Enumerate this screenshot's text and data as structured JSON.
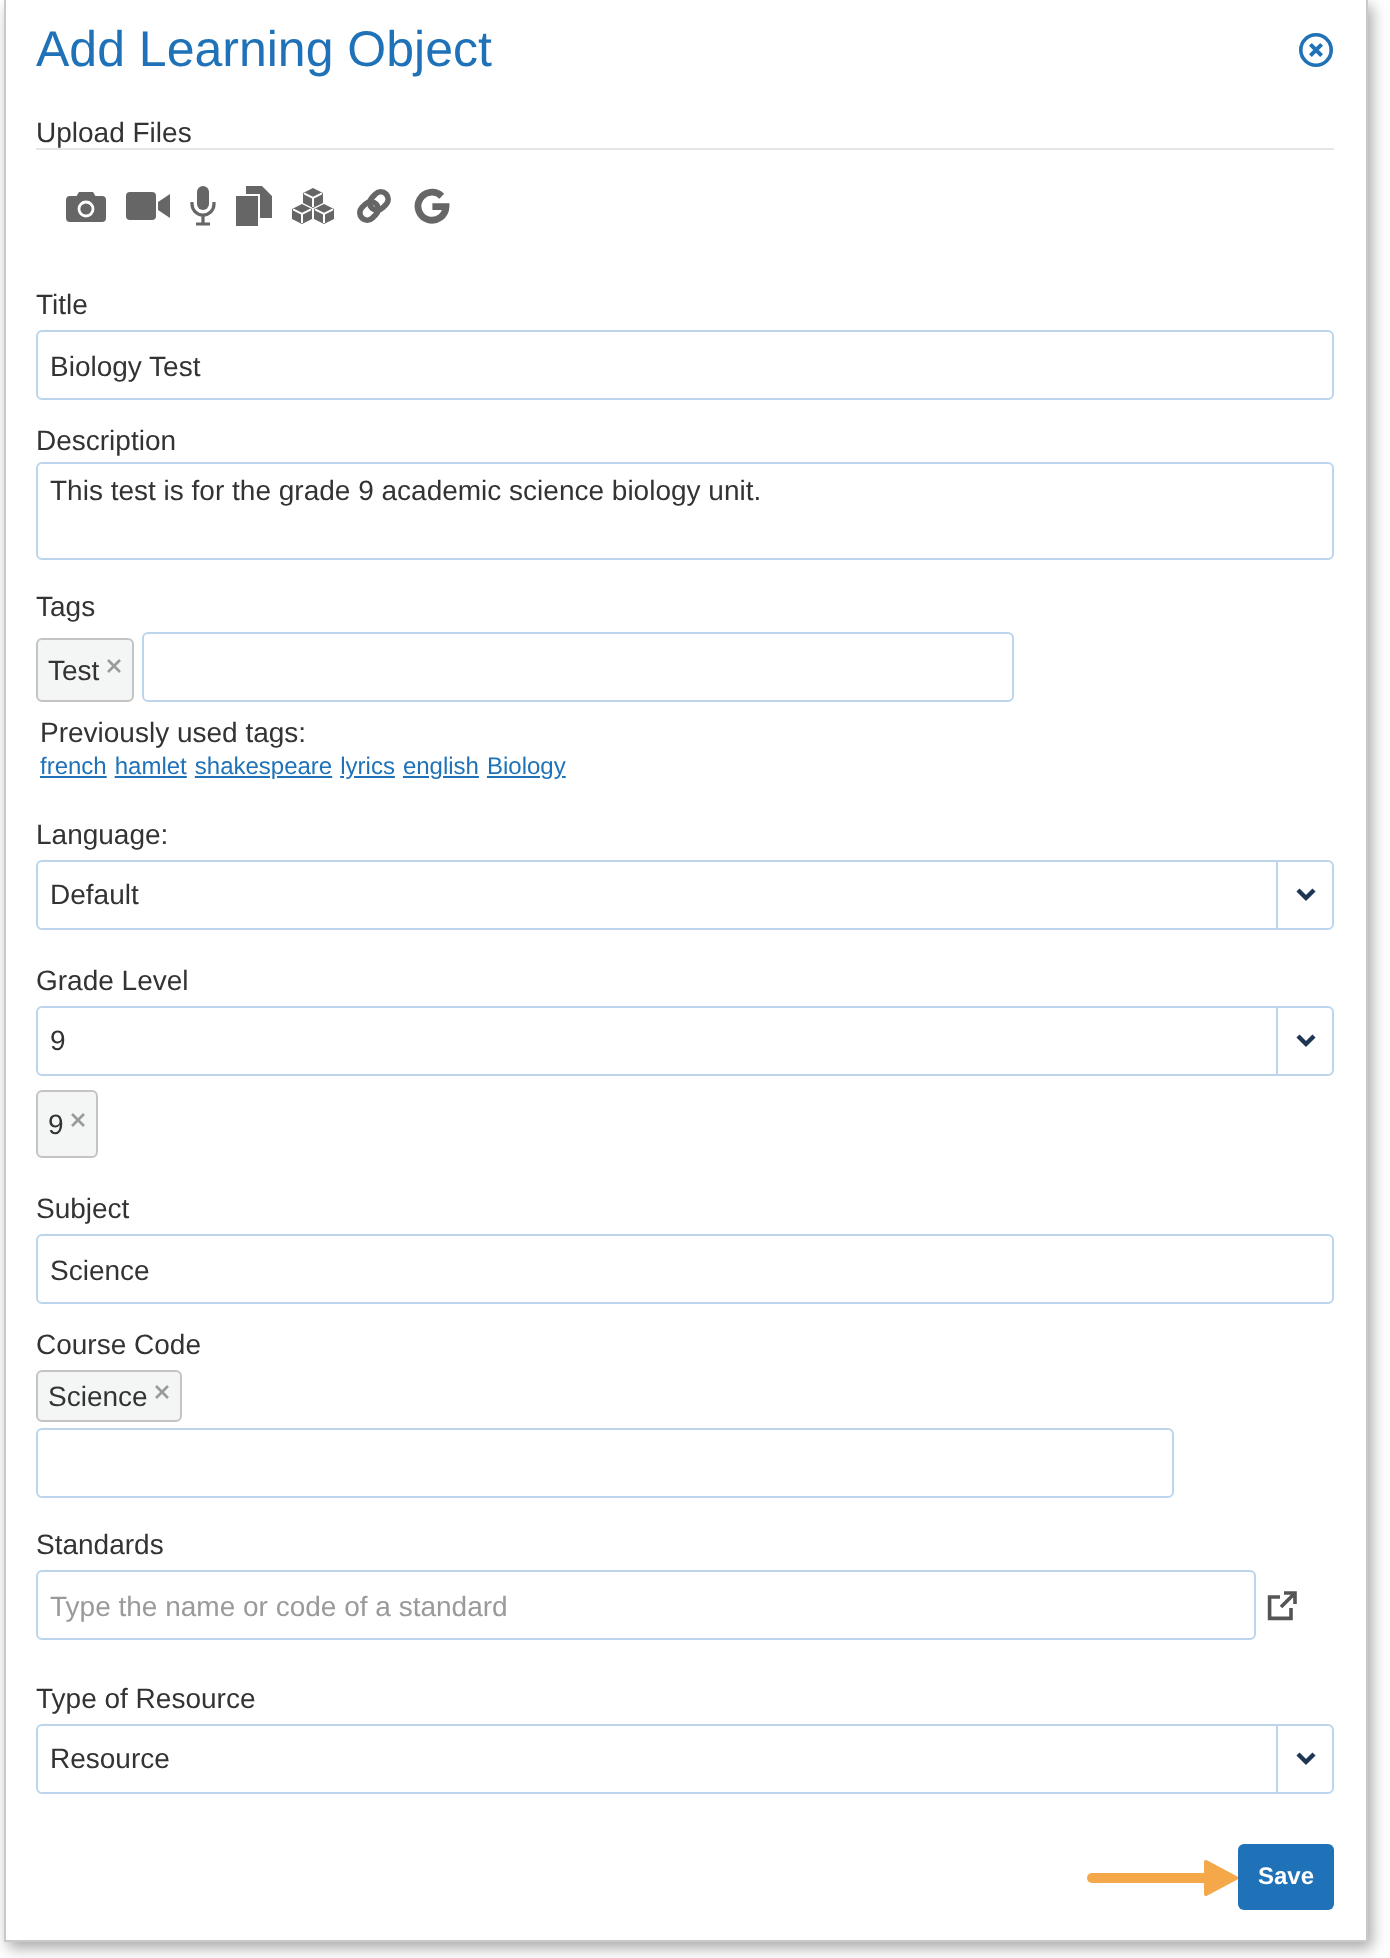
{
  "dialog": {
    "title": "Add Learning Object"
  },
  "upload": {
    "label": "Upload Files"
  },
  "fields": [
    {
      "kind": "text",
      "label": "Title",
      "value": "Biology Test"
    },
    {
      "kind": "textarea",
      "label": "Description",
      "value": "This test is for the grade 9 academic science biology unit."
    },
    {
      "kind": "tags",
      "label": "Tags",
      "tags": [
        "Test"
      ],
      "previous_label": "Previously used tags:",
      "previous_tags": [
        "french",
        "hamlet",
        "shakespeare",
        "lyrics",
        "english",
        "Biology"
      ]
    },
    {
      "kind": "select",
      "label": "Language:",
      "value": "Default"
    },
    {
      "kind": "select",
      "label": "Grade Level",
      "value": "9",
      "chips": [
        "9"
      ]
    },
    {
      "kind": "text",
      "label": "Subject",
      "value": "Science"
    },
    {
      "kind": "chip_input",
      "label": "Course Code",
      "chips": [
        "Science"
      ]
    },
    {
      "kind": "search",
      "label": "Standards",
      "placeholder": "Type the name or code of a standard"
    },
    {
      "kind": "select",
      "label": "Type of Resource",
      "value": "Resource"
    }
  ],
  "save_button": {
    "label": "Save"
  }
}
